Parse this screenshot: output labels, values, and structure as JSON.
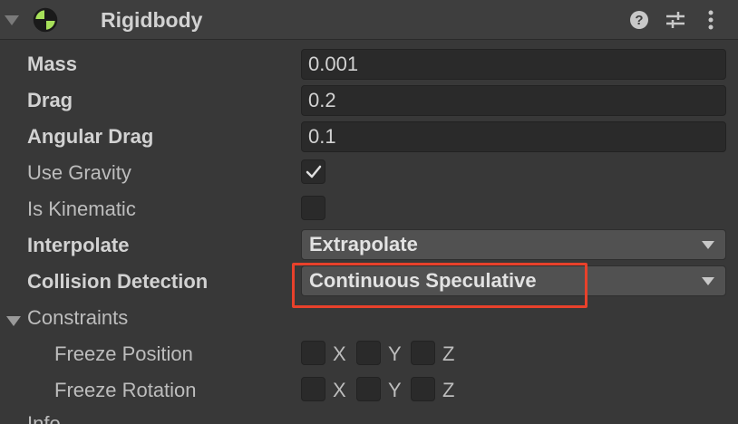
{
  "component": {
    "title": "Rigidbody",
    "icon": "rigidbody-icon",
    "header_icons": [
      "help-icon",
      "presets-icon",
      "more-icon"
    ]
  },
  "fields": {
    "mass": {
      "label": "Mass",
      "value": "0.001"
    },
    "drag": {
      "label": "Drag",
      "value": "0.2"
    },
    "angular_drag": {
      "label": "Angular Drag",
      "value": "0.1"
    },
    "use_gravity": {
      "label": "Use Gravity",
      "checked": true
    },
    "is_kinematic": {
      "label": "Is Kinematic",
      "checked": false
    },
    "interpolate": {
      "label": "Interpolate",
      "value": "Extrapolate"
    },
    "collision_detection": {
      "label": "Collision Detection",
      "value": "Continuous Speculative"
    }
  },
  "constraints": {
    "label": "Constraints",
    "freeze_position": {
      "label": "Freeze Position",
      "axes": [
        "X",
        "Y",
        "Z"
      ]
    },
    "freeze_rotation": {
      "label": "Freeze Rotation",
      "axes": [
        "X",
        "Y",
        "Z"
      ]
    }
  },
  "info": {
    "label": "Info"
  },
  "colors": {
    "highlight": "#e8412b",
    "icon_green": "#a7e05a"
  }
}
